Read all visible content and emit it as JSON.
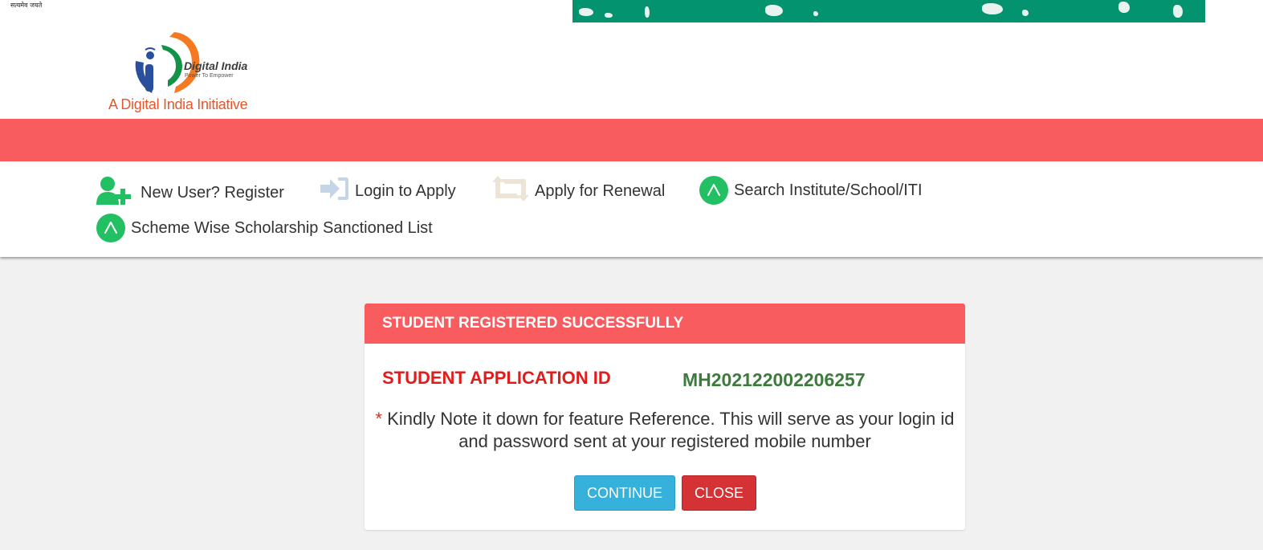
{
  "header": {
    "motto": "सत्यमेव जयते",
    "logo": {
      "brand": "Digital India",
      "brand_sub": "Power To Empower",
      "tagline": "A Digital India Initiative"
    }
  },
  "nav": {
    "items": [
      {
        "label": "New User? Register",
        "icon": "add-user-icon"
      },
      {
        "label": "Login to Apply",
        "icon": "sign-in-icon"
      },
      {
        "label": "Apply for Renewal",
        "icon": "retweet-icon"
      },
      {
        "label": "Search Institute/School/ITI",
        "icon": "circle-a-icon"
      },
      {
        "label": "Scheme Wise Scholarship Sanctioned List",
        "icon": "circle-a-icon"
      }
    ]
  },
  "modal": {
    "title": "STUDENT REGISTERED SUCCESSFULLY",
    "app_id_label": "STUDENT APPLICATION ID",
    "app_id_value": "MH202122002206257",
    "note_star": "*",
    "note": "Kindly Note it down for feature Reference. This will serve as your login id and password sent at your registered mobile number",
    "continue_label": "CONTINUE",
    "close_label": "CLOSE"
  },
  "colors": {
    "accent_red": "#f95c5f",
    "app_id_green": "#3d7b3d",
    "label_red": "#e21b1b",
    "icon_green": "#22bf63",
    "continue_blue": "#36b1dc",
    "close_red": "#d43234",
    "banner_green": "#04936f"
  }
}
